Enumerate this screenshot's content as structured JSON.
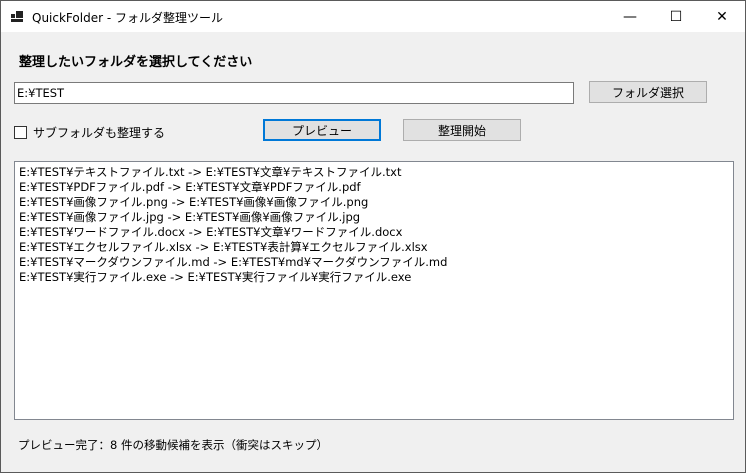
{
  "window": {
    "title": "QuickFolder - フォルダ整理ツール",
    "minimize": "—",
    "maximize": "☐",
    "close": "✕"
  },
  "heading": "整理したいフォルダを選択してください",
  "folder_input": {
    "value": "E:¥TEST"
  },
  "buttons": {
    "select_folder": "フォルダ選択",
    "preview": "プレビュー",
    "start": "整理開始"
  },
  "subfolder_checkbox": {
    "label": "サブフォルダも整理する",
    "checked": false
  },
  "preview_list": [
    "E:¥TEST¥テキストファイル.txt  ->  E:¥TEST¥文章¥テキストファイル.txt",
    "E:¥TEST¥PDFファイル.pdf  ->  E:¥TEST¥文章¥PDFファイル.pdf",
    "E:¥TEST¥画像ファイル.png  ->  E:¥TEST¥画像¥画像ファイル.png",
    "E:¥TEST¥画像ファイル.jpg  ->  E:¥TEST¥画像¥画像ファイル.jpg",
    "E:¥TEST¥ワードファイル.docx  ->  E:¥TEST¥文章¥ワードファイル.docx",
    "E:¥TEST¥エクセルファイル.xlsx  ->  E:¥TEST¥表計算¥エクセルファイル.xlsx",
    "E:¥TEST¥マークダウンファイル.md  ->  E:¥TEST¥md¥マークダウンファイル.md",
    "E:¥TEST¥実行ファイル.exe  ->  E:¥TEST¥実行ファイル¥実行ファイル.exe"
  ],
  "status": "プレビュー完了：8 件の移動候補を表示（衝突はスキップ）"
}
